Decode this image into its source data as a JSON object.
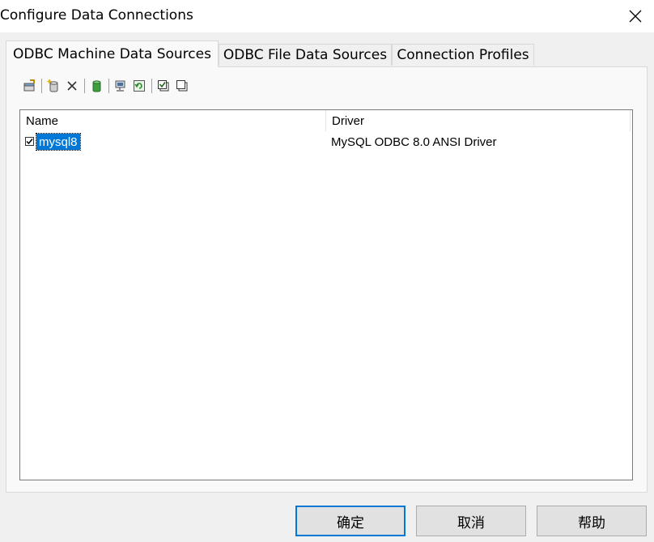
{
  "window": {
    "title": "Configure Data Connections"
  },
  "tabs": [
    {
      "label": "ODBC Machine Data Sources",
      "active": true
    },
    {
      "label": "ODBC File Data Sources",
      "active": false
    },
    {
      "label": "Connection Profiles",
      "active": false
    }
  ],
  "toolbar": {
    "buttons": [
      "properties-icon",
      "new-data-source-icon",
      "delete-icon",
      "database-icon",
      "network-database-icon",
      "refresh-icon",
      "select-all-icon",
      "clear-selection-icon"
    ]
  },
  "list": {
    "columns": [
      "Name",
      "Driver"
    ],
    "rows": [
      {
        "name": "mysql8",
        "driver": "MySQL ODBC 8.0 ANSI Driver",
        "checked": true,
        "selected": true
      }
    ]
  },
  "buttons": {
    "ok": "确定",
    "cancel": "取消",
    "help": "帮助"
  },
  "colors": {
    "selection": "#0078d7",
    "default_button_border": "#0078d7"
  }
}
